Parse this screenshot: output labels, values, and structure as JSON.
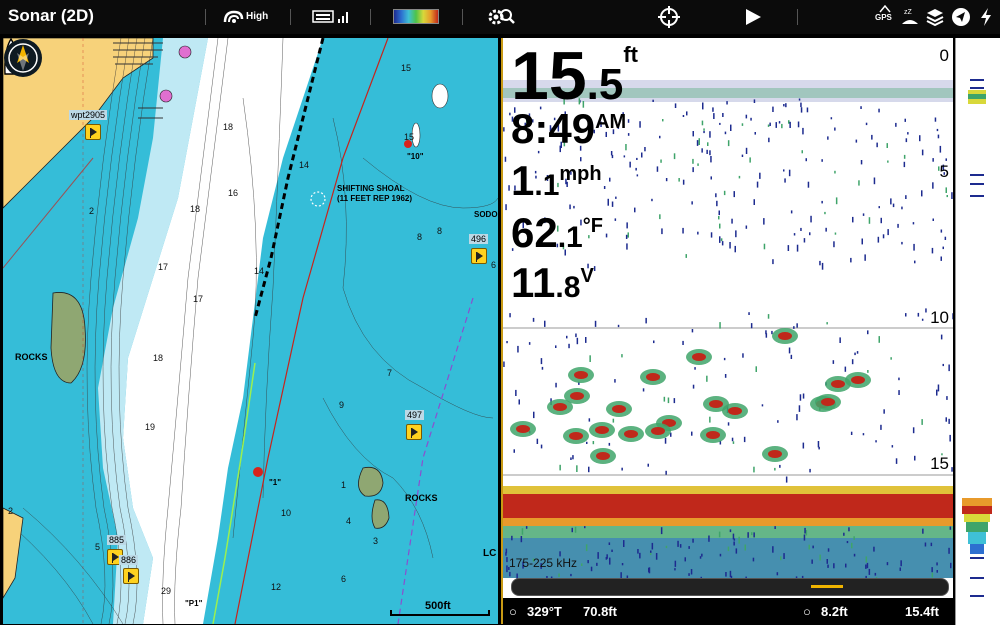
{
  "app": {
    "title": "Sonar (2D)"
  },
  "toolbar": {
    "sensitivity_label": "High",
    "gps_label": "GPS",
    "icons": [
      "sonar-sensitivity-icon",
      "keyboard-icon",
      "signal-icon",
      "palette-swatch",
      "gear-search-icon",
      "crosshair-icon",
      "play-icon",
      "gps-icon",
      "sleep-icon",
      "layers-icon",
      "navigation-icon",
      "power-icon"
    ]
  },
  "chart": {
    "waypoints": [
      {
        "name": "wpt2905"
      },
      {
        "name": "496"
      },
      {
        "name": "497"
      },
      {
        "name": "885"
      },
      {
        "name": "886"
      }
    ],
    "labels": {
      "rocks_left": "ROCKS",
      "rocks_right": "ROCKS",
      "shoal_line1": "SHIFTING SHOAL",
      "shoal_line2": "(11 FEET REP 1962)",
      "marker_10": "\"10\"",
      "marker_1": "\"1\"",
      "marker_p1": "\"P1\"",
      "sodo": "SODO",
      "lc": "LC"
    },
    "depths": [
      "15",
      "15",
      "14",
      "18",
      "16",
      "18",
      "17",
      "2",
      "17",
      "14",
      "8",
      "8",
      "6",
      "18",
      "7",
      "9",
      "19",
      "1",
      "10",
      "3",
      "4",
      "2",
      "5",
      "6",
      "29",
      "12"
    ],
    "scale": "500ft"
  },
  "sonar": {
    "depth": {
      "whole": "15",
      "frac": ".5",
      "unit": "ft"
    },
    "time": {
      "whole": "8:49",
      "unit": "AM"
    },
    "speed": {
      "whole": "1",
      "frac": ".1",
      "unit": "mph"
    },
    "water_temp": {
      "whole": "62",
      "frac": ".1",
      "unit": "°F"
    },
    "voltage": {
      "whole": "11",
      "frac": ".8",
      "unit": "V"
    },
    "depth_scale": [
      "0",
      "5",
      "10",
      "15"
    ],
    "frequency": "175-225 kHz",
    "zoom_position": 0.74,
    "status": {
      "heading": "329°T",
      "distance": "70.8ft",
      "cursor_depth": "8.2ft",
      "depth_right": "15.4ft"
    }
  },
  "colors": {
    "accent": "#c89a14",
    "water": "#35bdd8",
    "shallow": "#ffffff",
    "land": "#f7d27a",
    "sonar_bottom": "#c0281b"
  }
}
